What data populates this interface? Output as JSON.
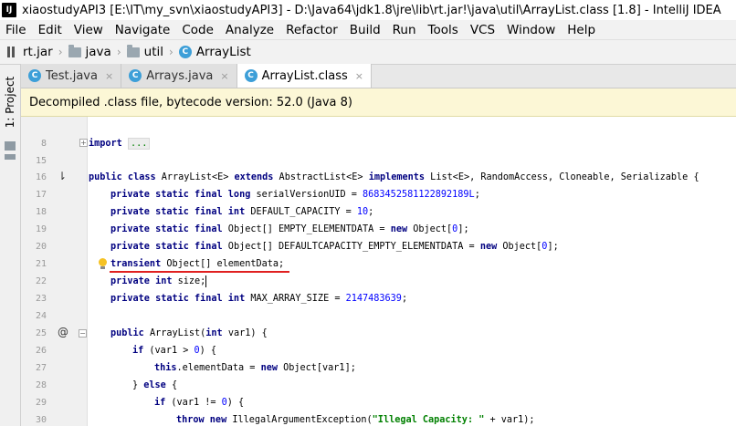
{
  "window": {
    "app_icon": "IJ",
    "title": "xiaostudyAPI3 [E:\\IT\\my_svn\\xiaostudyAPI3] - D:\\Java64\\jdk1.8\\jre\\lib\\rt.jar!\\java\\util\\ArrayList.class [1.8] - IntelliJ IDEA"
  },
  "menu": [
    "File",
    "Edit",
    "View",
    "Navigate",
    "Code",
    "Analyze",
    "Refactor",
    "Build",
    "Run",
    "Tools",
    "VCS",
    "Window",
    "Help"
  ],
  "breadcrumb": {
    "items": [
      {
        "label": "rt.jar",
        "icon": "jar-icon"
      },
      {
        "label": "java",
        "icon": "folder-icon"
      },
      {
        "label": "util",
        "icon": "folder-icon"
      },
      {
        "label": "ArrayList",
        "icon": "class-icon"
      }
    ],
    "separator": "›"
  },
  "side_panel": {
    "project_tab": "1: Project"
  },
  "tabs": [
    {
      "label": "Test.java",
      "icon": "C",
      "active": false
    },
    {
      "label": "Arrays.java",
      "icon": "C",
      "active": false
    },
    {
      "label": "ArrayList.class",
      "icon": "C",
      "active": true
    }
  ],
  "tab_close_glyph": "×",
  "banner": {
    "text": "Decompiled .class file, bytecode version: 52.0 (Java 8)"
  },
  "editor": {
    "line_numbers": [
      "8",
      "15",
      "16",
      "17",
      "18",
      "19",
      "20",
      "21",
      "22",
      "23",
      "24",
      "25",
      "26",
      "27",
      "28",
      "29",
      "30"
    ],
    "gutter_marks": {
      "fold_plus": "+",
      "fold_minus": "−",
      "override_mark": "@",
      "impl_mark": "⇂"
    },
    "lines": {
      "l8": {
        "kw": "import",
        "fold": "..."
      },
      "l16": {
        "k1": "public class",
        "t1": " ArrayList<E> ",
        "k2": "extends",
        "t2": " AbstractList<E> ",
        "k3": "implements",
        "t3": " List<E>, RandomAccess, Cloneable, Serializable {"
      },
      "l17": {
        "k1": "private static final long",
        "t1": " serialVersionUID = ",
        "num": "8683452581122892189L",
        "t2": ";"
      },
      "l18": {
        "k1": "private static final int",
        "t1": " DEFAULT_CAPACITY = ",
        "num": "10",
        "t2": ";"
      },
      "l19": {
        "k1": "private static final",
        "t1": " Object[] EMPTY_ELEMENTDATA = ",
        "k2": "new",
        "t2": " Object[",
        "num": "0",
        "t3": "];"
      },
      "l20": {
        "k1": "private static final",
        "t1": " Object[] DEFAULTCAPACITY_EMPTY_ELEMENTDATA = ",
        "k2": "new",
        "t2": " Object[",
        "num": "0",
        "t3": "];"
      },
      "l21": {
        "k1": "transient",
        "t1": " Object[] elementData;"
      },
      "l22": {
        "k1": "private int",
        "t1": " size;"
      },
      "l23": {
        "k1": "private static final int",
        "t1": " MAX_ARRAY_SIZE = ",
        "num": "2147483639",
        "t2": ";"
      },
      "l25": {
        "k1": "public",
        "t1": " ArrayList(",
        "k2": "int",
        "t2": " var1) {"
      },
      "l26": {
        "k1": "if",
        "t1": " (var1 > ",
        "num": "0",
        "t2": ") {"
      },
      "l27": {
        "k1": "this",
        "t1": ".elementData = ",
        "k2": "new",
        "t2": " Object[var1];"
      },
      "l28": {
        "t1": "} ",
        "k1": "else",
        "t2": " {"
      },
      "l29": {
        "k1": "if",
        "t1": " (var1 != ",
        "num": "0",
        "t2": ") {"
      },
      "l30": {
        "k1": "throw new",
        "t1": " IllegalArgumentException(",
        "str": "\"Illegal Capacity: \"",
        "t2": " + var1);"
      }
    }
  },
  "colors": {
    "keyword": "#000080",
    "number": "#0000ff",
    "string": "#008000",
    "banner_bg": "#fcf7d6",
    "underline": "#e02020",
    "class_icon": "#3d9fd8"
  }
}
